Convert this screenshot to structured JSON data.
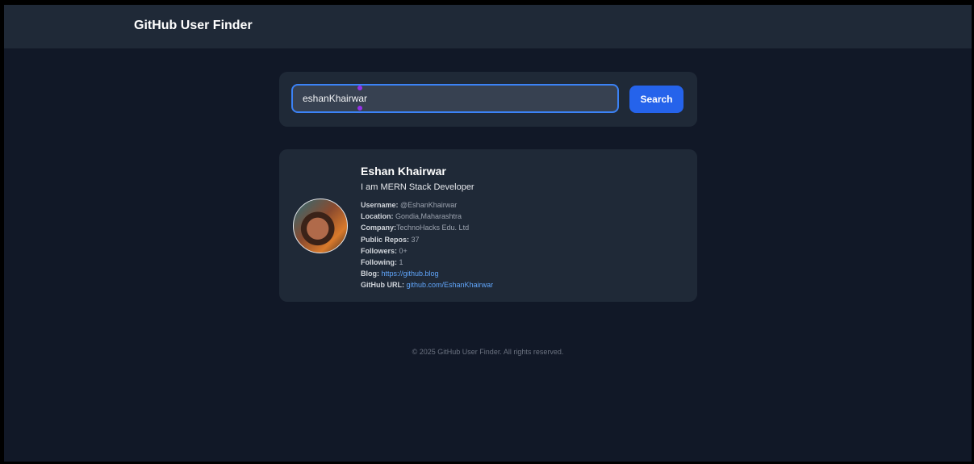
{
  "header": {
    "title": "GitHub User Finder"
  },
  "search": {
    "value": "eshanKhairwar",
    "button_label": "Search"
  },
  "profile": {
    "name": "Eshan Khairwar",
    "bio": "I am MERN Stack Developer",
    "fields": {
      "username": {
        "label": "Username:",
        "value": "@EshanKhairwar"
      },
      "location": {
        "label": "Location:",
        "value": "Gondia,Maharashtra"
      },
      "company": {
        "label": "Company:",
        "value": "TechnoHacks Edu. Ltd"
      },
      "public_repos": {
        "label": "Public Repos:",
        "value": "37"
      },
      "followers": {
        "label": "Followers:",
        "value": "0+"
      },
      "following": {
        "label": "Following:",
        "value": "1"
      },
      "blog": {
        "label": "Blog:",
        "value": "https://github.blog"
      },
      "github_url": {
        "label": "GitHub URL:",
        "value": "github.com/EshanKhairwar"
      }
    }
  },
  "footer": {
    "text": "© 2025 GitHub User Finder. All rights reserved."
  },
  "colors": {
    "page_bg": "#111827",
    "card_bg": "#1f2937",
    "accent": "#2563eb",
    "link": "#60a5fa",
    "input_border": "#3b82f6"
  }
}
